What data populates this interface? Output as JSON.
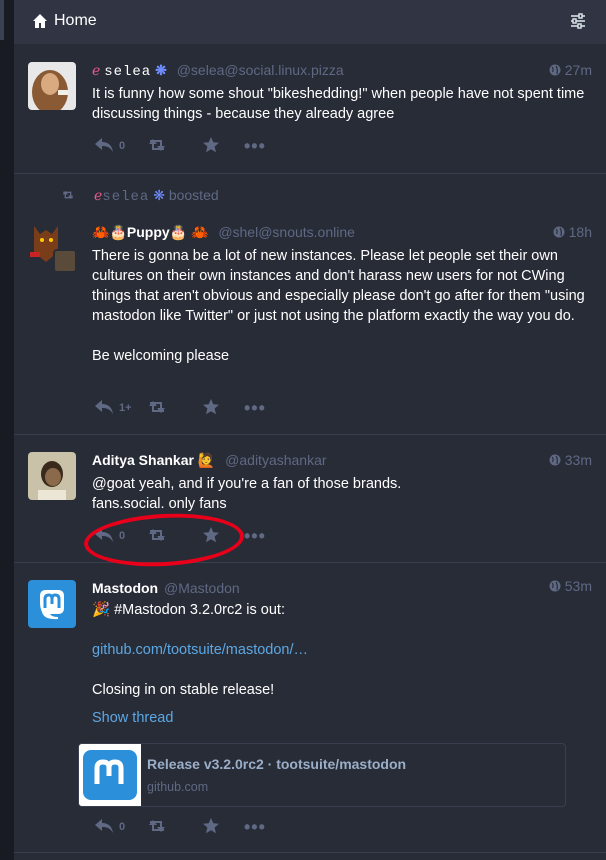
{
  "header": {
    "title": "Home",
    "home_icon": "home-icon",
    "settings_icon": "sliders-icon"
  },
  "statuses": [
    {
      "display_name": "ℰseleaⓢ",
      "display_name_plain": "selea",
      "handle": "@selea@social.linux.pizza",
      "time": "27m",
      "text": "It is funny how some shout \"bikeshedding!\" when people have not spent time discussing things - because they already agree",
      "reply_count": "0"
    },
    {
      "boosted_by": "selea",
      "boosted_label": "boosted",
      "display_name": "Puppy",
      "handle": "@shel@snouts.online",
      "time": "18h",
      "paragraph1": "There is gonna be a lot of new instances. Please let people set their own cultures on their own instances and don't harass new users for not CWing things that aren't obvious and especially please don't go after for them \"using mastodon like Twitter\" or just not using the platform exactly the way you do.",
      "paragraph2": "Be welcoming please",
      "reply_count": "1+"
    },
    {
      "display_name": "Aditya Shankar",
      "handle": "@adityashankar",
      "time": "33m",
      "line1": "@goat yeah, and if you're a fan of those brands.",
      "line2": "fans.social. only fans",
      "reply_count": "0"
    },
    {
      "display_name": "Mastodon",
      "handle": "@Mastodon",
      "time": "53m",
      "line1": "#Mastodon 3.2.0rc2 is out:",
      "link": "github.com/tootsuite/mastodon/…",
      "line2": "Closing in on stable release!",
      "show_thread": "Show thread",
      "card_title": "Release v3.2.0rc2 · tootsuite/mastodon",
      "card_host": "github.com",
      "reply_count": "0"
    }
  ],
  "colors": {
    "accent": "#8c8dff",
    "muted": "#606984",
    "background": "#282c37",
    "annotation": "#e8001a"
  }
}
